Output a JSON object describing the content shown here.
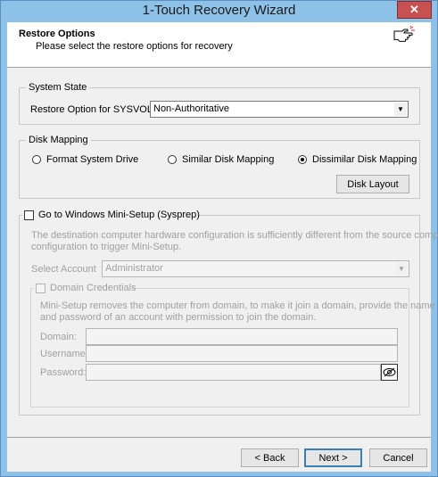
{
  "window": {
    "title": "1-Touch Recovery Wizard",
    "close_glyph": "✕"
  },
  "header": {
    "title": "Restore Options",
    "subtitle": "Please select the restore options for recovery",
    "icon": "pointing-hand-icon"
  },
  "system_state": {
    "legend": "System State",
    "sysvol_label": "Restore Option for SYSVOL:",
    "sysvol_value": "Non-Authoritative"
  },
  "disk_mapping": {
    "legend": "Disk Mapping",
    "options": [
      {
        "label": "Format System Drive",
        "selected": false
      },
      {
        "label": "Similar Disk Mapping",
        "selected": false
      },
      {
        "label": "Dissimilar Disk Mapping",
        "selected": true
      }
    ],
    "disk_layout_label": "Disk Layout"
  },
  "mini_setup": {
    "legend": "Go to Windows Mini-Setup (Sysprep)",
    "checked": false,
    "description_line1": "The destination computer hardware configuration is sufficiently different from the source computer",
    "description_line2": "configuration to trigger Mini-Setup.",
    "select_account_label": "Select Account",
    "account_value": "Administrator",
    "domain_credentials": {
      "legend": "Domain Credentials",
      "checked": false,
      "description_line1": "Mini-Setup removes the computer from domain, to make it join a domain, provide the name",
      "description_line2": "and password of an account with permission to join the domain.",
      "domain_label": "Domain:",
      "username_label": "Username:",
      "password_label": "Password:",
      "domain_value": "",
      "username_value": "",
      "password_value": ""
    }
  },
  "footer": {
    "back_label": "< Back",
    "next_label": "Next >",
    "cancel_label": "Cancel"
  }
}
